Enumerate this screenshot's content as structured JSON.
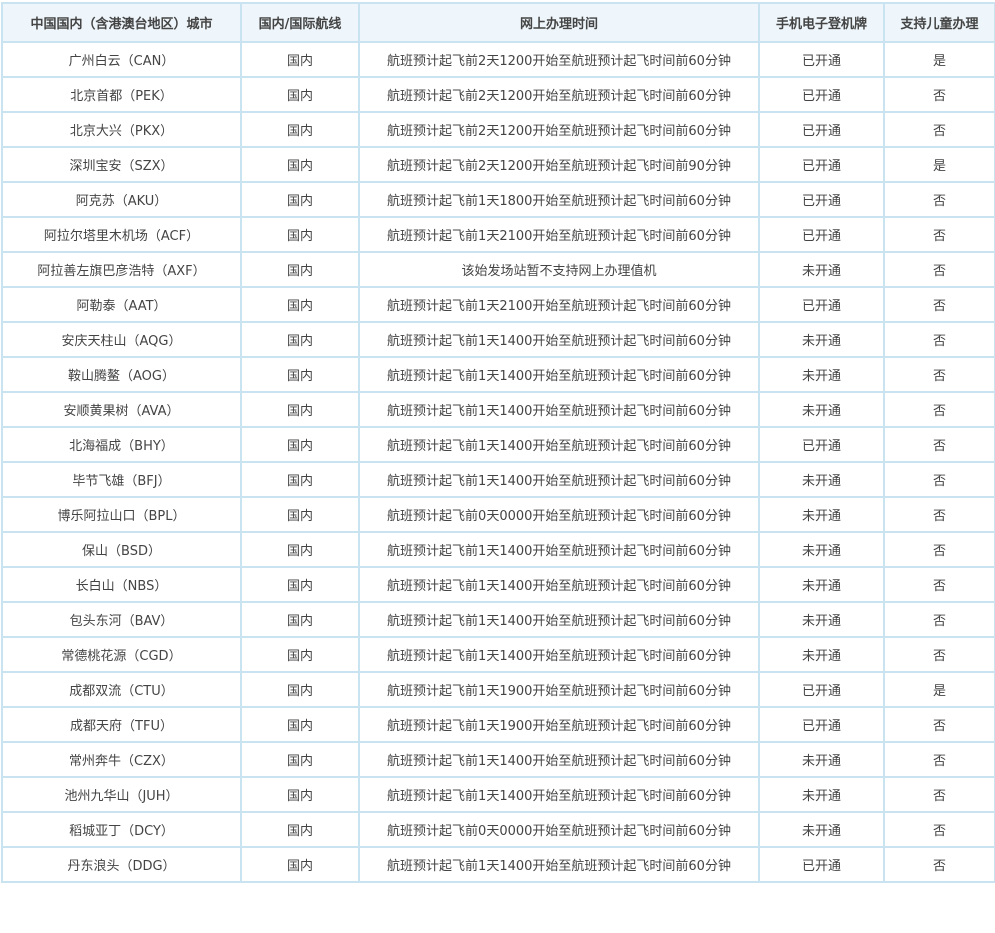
{
  "table": {
    "headers": [
      "中国国内（含港澳台地区）城市",
      "国内/国际航线",
      "网上办理时间",
      "手机电子登机牌",
      "支持儿童办理"
    ],
    "rows": [
      [
        "广州白云（CAN）",
        "国内",
        "航班预计起飞前2天1200开始至航班预计起飞时间前60分钟",
        "已开通",
        "是"
      ],
      [
        "北京首都（PEK）",
        "国内",
        "航班预计起飞前2天1200开始至航班预计起飞时间前60分钟",
        "已开通",
        "否"
      ],
      [
        "北京大兴（PKX）",
        "国内",
        "航班预计起飞前2天1200开始至航班预计起飞时间前60分钟",
        "已开通",
        "否"
      ],
      [
        "深圳宝安（SZX）",
        "国内",
        "航班预计起飞前2天1200开始至航班预计起飞时间前90分钟",
        "已开通",
        "是"
      ],
      [
        "阿克苏（AKU）",
        "国内",
        "航班预计起飞前1天1800开始至航班预计起飞时间前60分钟",
        "已开通",
        "否"
      ],
      [
        "阿拉尔塔里木机场（ACF）",
        "国内",
        "航班预计起飞前1天2100开始至航班预计起飞时间前60分钟",
        "已开通",
        "否"
      ],
      [
        "阿拉善左旗巴彦浩特（AXF）",
        "国内",
        "该始发场站暂不支持网上办理值机",
        "未开通",
        "否"
      ],
      [
        "阿勒泰（AAT）",
        "国内",
        "航班预计起飞前1天2100开始至航班预计起飞时间前60分钟",
        "已开通",
        "否"
      ],
      [
        "安庆天柱山（AQG）",
        "国内",
        "航班预计起飞前1天1400开始至航班预计起飞时间前60分钟",
        "未开通",
        "否"
      ],
      [
        "鞍山腾鳌（AOG）",
        "国内",
        "航班预计起飞前1天1400开始至航班预计起飞时间前60分钟",
        "未开通",
        "否"
      ],
      [
        "安顺黄果树（AVA）",
        "国内",
        "航班预计起飞前1天1400开始至航班预计起飞时间前60分钟",
        "未开通",
        "否"
      ],
      [
        "北海福成（BHY）",
        "国内",
        "航班预计起飞前1天1400开始至航班预计起飞时间前60分钟",
        "已开通",
        "否"
      ],
      [
        "毕节飞雄（BFJ）",
        "国内",
        "航班预计起飞前1天1400开始至航班预计起飞时间前60分钟",
        "未开通",
        "否"
      ],
      [
        "博乐阿拉山口（BPL）",
        "国内",
        "航班预计起飞前0天0000开始至航班预计起飞时间前60分钟",
        "未开通",
        "否"
      ],
      [
        "保山（BSD）",
        "国内",
        "航班预计起飞前1天1400开始至航班预计起飞时间前60分钟",
        "未开通",
        "否"
      ],
      [
        "长白山（NBS）",
        "国内",
        "航班预计起飞前1天1400开始至航班预计起飞时间前60分钟",
        "未开通",
        "否"
      ],
      [
        "包头东河（BAV）",
        "国内",
        "航班预计起飞前1天1400开始至航班预计起飞时间前60分钟",
        "未开通",
        "否"
      ],
      [
        "常德桃花源（CGD）",
        "国内",
        "航班预计起飞前1天1400开始至航班预计起飞时间前60分钟",
        "未开通",
        "否"
      ],
      [
        "成都双流（CTU）",
        "国内",
        "航班预计起飞前1天1900开始至航班预计起飞时间前60分钟",
        "已开通",
        "是"
      ],
      [
        "成都天府（TFU）",
        "国内",
        "航班预计起飞前1天1900开始至航班预计起飞时间前60分钟",
        "已开通",
        "否"
      ],
      [
        "常州奔牛（CZX）",
        "国内",
        "航班预计起飞前1天1400开始至航班预计起飞时间前60分钟",
        "未开通",
        "否"
      ],
      [
        "池州九华山（JUH）",
        "国内",
        "航班预计起飞前1天1400开始至航班预计起飞时间前60分钟",
        "未开通",
        "否"
      ],
      [
        "稻城亚丁（DCY）",
        "国内",
        "航班预计起飞前0天0000开始至航班预计起飞时间前60分钟",
        "未开通",
        "否"
      ],
      [
        "丹东浪头（DDG）",
        "国内",
        "航班预计起飞前1天1400开始至航班预计起飞时间前60分钟",
        "已开通",
        "否"
      ]
    ]
  }
}
